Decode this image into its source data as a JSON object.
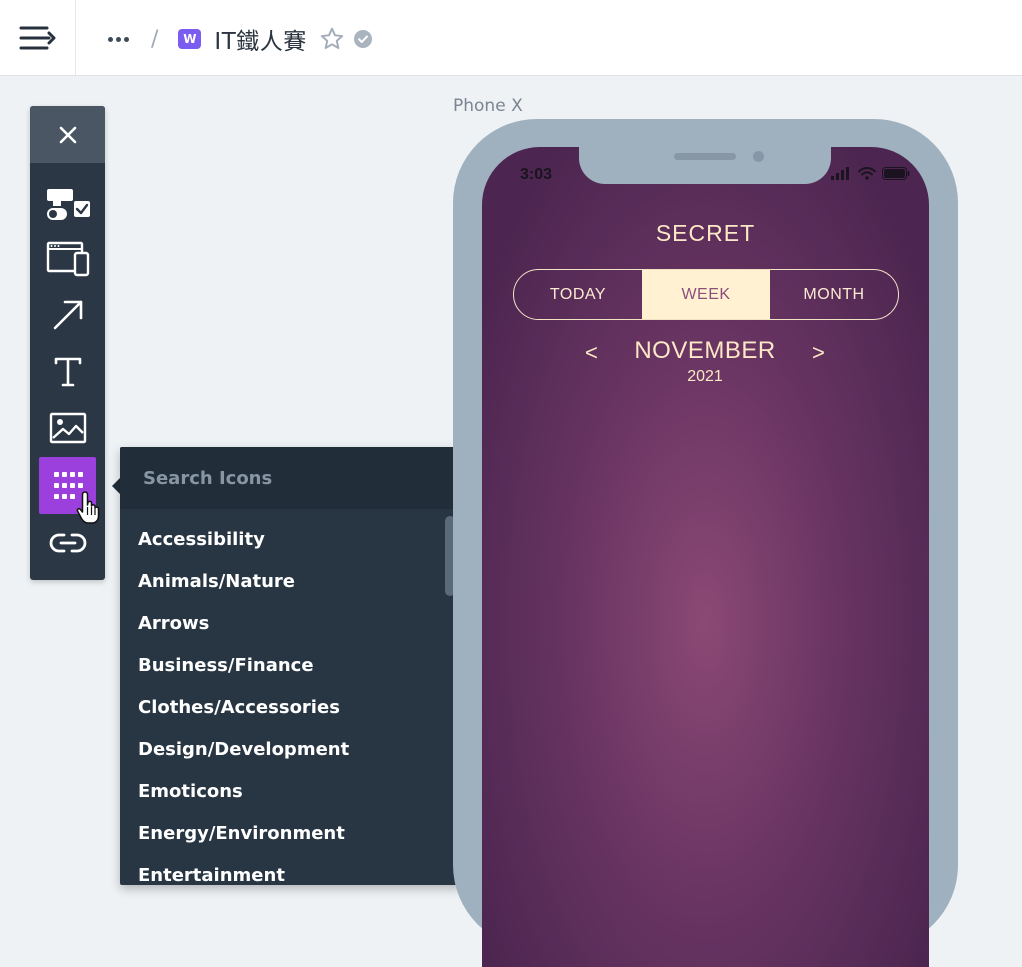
{
  "header": {
    "badge_letter": "W",
    "project_title": "IT鐵人賽",
    "separator": "/"
  },
  "toolbar": {
    "tools": [
      "close-icon",
      "ui-controls-icon",
      "responsive-devices-icon",
      "arrow-icon",
      "text-icon",
      "image-icon",
      "icon-grid-icon",
      "link-icon"
    ],
    "active_tool": "icon-grid-icon",
    "active_color": "#9b40dd"
  },
  "icon_panel": {
    "search_placeholder": "Search Icons",
    "categories": [
      "Accessibility",
      "Animals/Nature",
      "Arrows",
      "Business/Finance",
      "Clothes/Accessories",
      "Design/Development",
      "Emoticons",
      "Energy/Environment",
      "Entertainment"
    ]
  },
  "canvas": {
    "frame_label": "Phone X"
  },
  "phone": {
    "time": "3:03",
    "app_title": "SECRET",
    "tabs": [
      {
        "label": "TODAY",
        "selected": false
      },
      {
        "label": "WEEK",
        "selected": true
      },
      {
        "label": "MONTH",
        "selected": false
      }
    ],
    "prev_label": "<",
    "next_label": ">",
    "month": "NOVEMBER",
    "year": "2021",
    "accent_color": "#fce8c6",
    "background_color": "#6a3563"
  }
}
